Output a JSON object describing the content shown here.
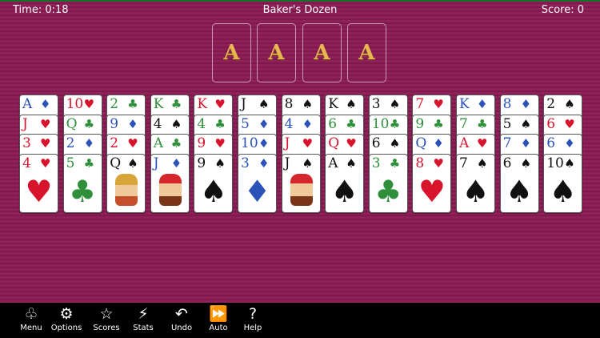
{
  "header": {
    "time": "Time: 0:18",
    "title": "Baker's Dozen",
    "score": "Score: 0"
  },
  "foundations": [
    "A",
    "A",
    "A",
    "A"
  ],
  "suit_glyphs": {
    "hearts": "♥",
    "diamonds": "♦",
    "clubs": "♣",
    "spades": "♠"
  },
  "columns": [
    [
      {
        "rank": "A",
        "suit": "diamonds"
      },
      {
        "rank": "J",
        "suit": "hearts"
      },
      {
        "rank": "3",
        "suit": "hearts"
      },
      {
        "rank": "4",
        "suit": "hearts"
      }
    ],
    [
      {
        "rank": "10",
        "suit": "hearts"
      },
      {
        "rank": "Q",
        "suit": "clubs"
      },
      {
        "rank": "2",
        "suit": "diamonds"
      },
      {
        "rank": "5",
        "suit": "clubs"
      }
    ],
    [
      {
        "rank": "2",
        "suit": "clubs"
      },
      {
        "rank": "9",
        "suit": "diamonds"
      },
      {
        "rank": "2",
        "suit": "hearts"
      },
      {
        "rank": "Q",
        "suit": "spades"
      }
    ],
    [
      {
        "rank": "K",
        "suit": "clubs"
      },
      {
        "rank": "4",
        "suit": "spades"
      },
      {
        "rank": "A",
        "suit": "clubs"
      },
      {
        "rank": "J",
        "suit": "diamonds"
      }
    ],
    [
      {
        "rank": "K",
        "suit": "hearts"
      },
      {
        "rank": "4",
        "suit": "clubs"
      },
      {
        "rank": "9",
        "suit": "hearts"
      },
      {
        "rank": "9",
        "suit": "spades"
      }
    ],
    [
      {
        "rank": "J",
        "suit": "spades"
      },
      {
        "rank": "5",
        "suit": "diamonds"
      },
      {
        "rank": "10",
        "suit": "diamonds"
      },
      {
        "rank": "3",
        "suit": "diamonds"
      }
    ],
    [
      {
        "rank": "8",
        "suit": "spades"
      },
      {
        "rank": "4",
        "suit": "diamonds"
      },
      {
        "rank": "J",
        "suit": "hearts"
      },
      {
        "rank": "J",
        "suit": "spades"
      }
    ],
    [
      {
        "rank": "K",
        "suit": "spades"
      },
      {
        "rank": "6",
        "suit": "clubs"
      },
      {
        "rank": "Q",
        "suit": "hearts"
      },
      {
        "rank": "A",
        "suit": "spades"
      }
    ],
    [
      {
        "rank": "3",
        "suit": "spades"
      },
      {
        "rank": "10",
        "suit": "clubs"
      },
      {
        "rank": "6",
        "suit": "spades"
      },
      {
        "rank": "3",
        "suit": "clubs"
      }
    ],
    [
      {
        "rank": "7",
        "suit": "hearts"
      },
      {
        "rank": "9",
        "suit": "clubs"
      },
      {
        "rank": "Q",
        "suit": "diamonds"
      },
      {
        "rank": "8",
        "suit": "hearts"
      }
    ],
    [
      {
        "rank": "K",
        "suit": "diamonds"
      },
      {
        "rank": "7",
        "suit": "clubs"
      },
      {
        "rank": "A",
        "suit": "hearts"
      },
      {
        "rank": "7",
        "suit": "spades"
      }
    ],
    [
      {
        "rank": "8",
        "suit": "diamonds"
      },
      {
        "rank": "5",
        "suit": "spades"
      },
      {
        "rank": "7",
        "suit": "diamonds"
      },
      {
        "rank": "6",
        "suit": "spades"
      }
    ],
    [
      {
        "rank": "2",
        "suit": "spades"
      },
      {
        "rank": "6",
        "suit": "hearts"
      },
      {
        "rank": "6",
        "suit": "diamonds"
      },
      {
        "rank": "10",
        "suit": "spades"
      }
    ]
  ],
  "colors": {
    "hearts": "#d8142d",
    "diamonds": "#2a52b8",
    "clubs": "#2f8f3a",
    "spades": "#111111",
    "felt": "#8a1e55",
    "foundation_letter": "#e8b84e"
  },
  "toolbar": [
    {
      "label": "Menu",
      "icon": "suits-icon",
      "glyph": "♧"
    },
    {
      "label": "Options",
      "icon": "gear-icon",
      "glyph": "⚙"
    },
    {
      "label": "Scores",
      "icon": "star-icon",
      "glyph": "☆"
    },
    {
      "label": "Stats",
      "icon": "chart-icon",
      "glyph": "⚡"
    },
    {
      "label": "Undo",
      "icon": "undo-icon",
      "glyph": "↶"
    },
    {
      "label": "Auto",
      "icon": "fast-forward-icon",
      "glyph": "⏩"
    },
    {
      "label": "Help",
      "icon": "question-icon",
      "glyph": "?"
    }
  ]
}
